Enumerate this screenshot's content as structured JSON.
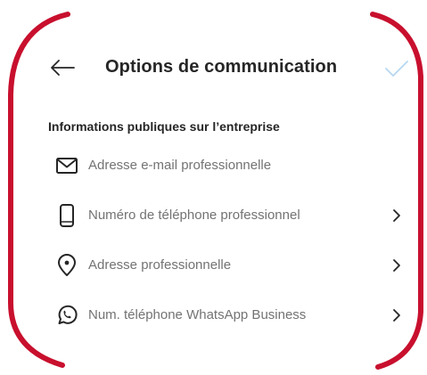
{
  "header": {
    "back_icon": "arrow-left-icon",
    "title": "Options de communication",
    "confirm_icon": "checkmark-icon"
  },
  "section": {
    "title": "Informations publiques sur l’entreprise"
  },
  "options": [
    {
      "icon": "envelope-icon",
      "label": "Adresse e-mail professionnelle",
      "has_chevron": false
    },
    {
      "icon": "phone-icon",
      "label": "Numéro de téléphone professionnel",
      "has_chevron": true
    },
    {
      "icon": "location-pin-icon",
      "label": "Adresse professionnelle",
      "has_chevron": true
    },
    {
      "icon": "whatsapp-icon",
      "label": "Num. téléphone WhatsApp Business",
      "has_chevron": true
    }
  ],
  "colors": {
    "frame_accent": "#c8102e",
    "text_primary": "#262626",
    "text_secondary": "#737373",
    "confirm_disabled": "#b7d7f0"
  }
}
